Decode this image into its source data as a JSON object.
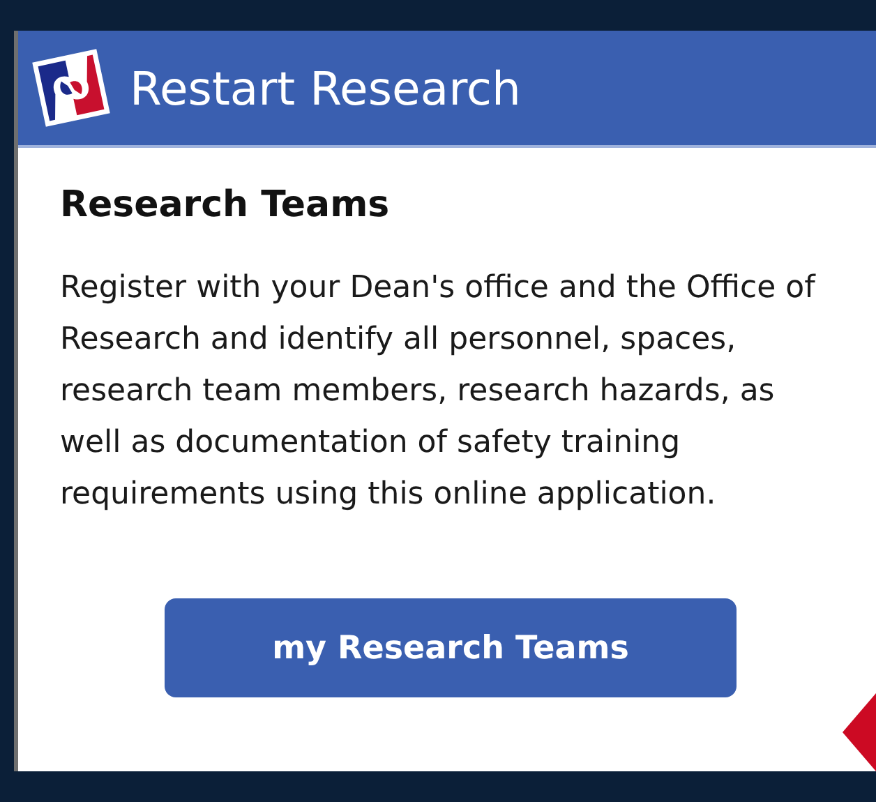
{
  "header": {
    "title": "Restart Research"
  },
  "section": {
    "heading": "Research Teams",
    "description": "Register with your Dean's office and the Office of Research and identify all personnel, spaces, research team members, research hazards, as well as documentation of safety training requirements using this online application.",
    "button": "my Research Teams"
  }
}
